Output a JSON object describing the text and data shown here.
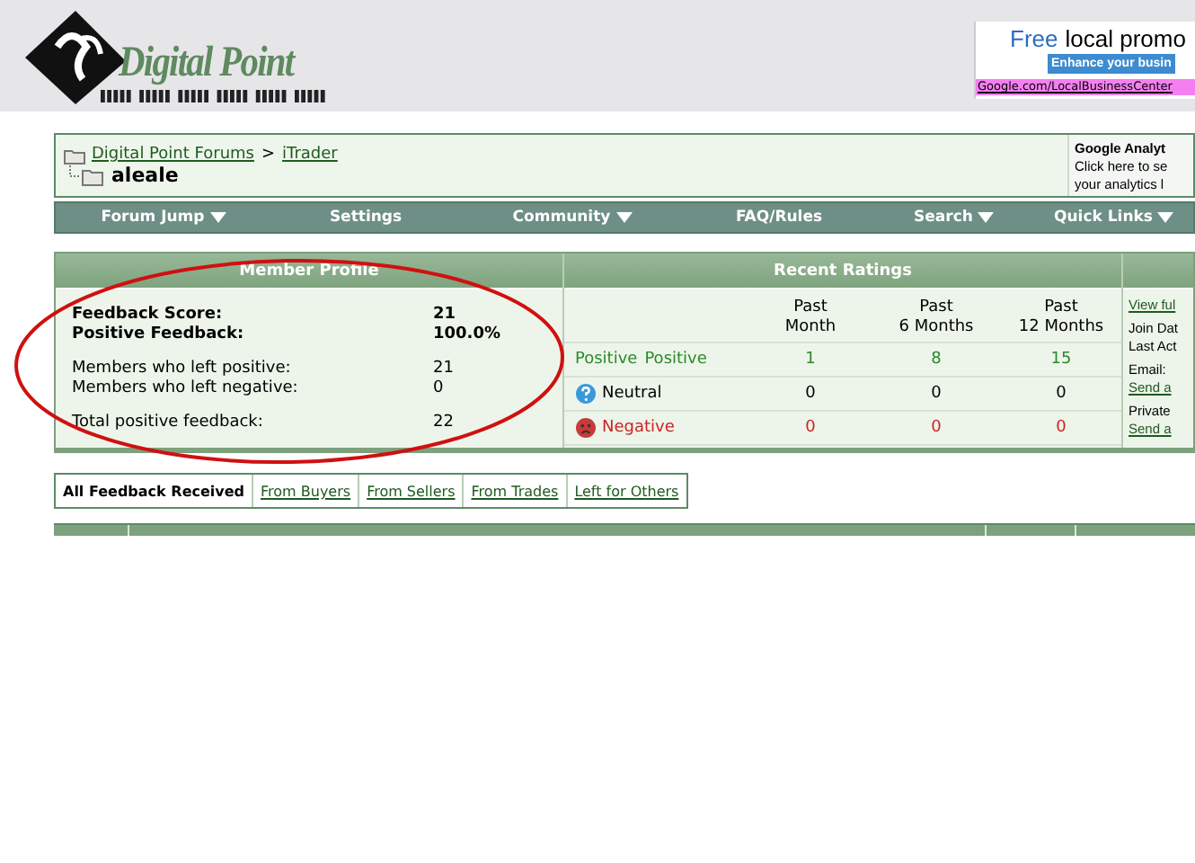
{
  "header": {
    "logo_text": "Digital Point",
    "ad": {
      "headline_free": "Free",
      "headline_rest": "local promo",
      "button": "Enhance your busin",
      "url": "Google.com/LocalBusinessCenter"
    }
  },
  "breadcrumb": {
    "links": [
      "Digital Point Forums",
      "iTrader"
    ],
    "separator": ">",
    "current": "aleale"
  },
  "side_promo": {
    "title": "Google Analyt",
    "lines": [
      "Click here to se",
      "your analytics l"
    ]
  },
  "navbar": [
    {
      "label": "Forum Jump",
      "has_menu": true
    },
    {
      "label": "Settings",
      "has_menu": false
    },
    {
      "label": "Community",
      "has_menu": true
    },
    {
      "label": "FAQ/Rules",
      "has_menu": false
    },
    {
      "label": "Search",
      "has_menu": true
    },
    {
      "label": "Quick Links",
      "has_menu": true
    }
  ],
  "member_profile": {
    "title": "Member Profile",
    "groups": [
      [
        {
          "label": "Feedback Score:",
          "value": "21",
          "bold": true
        },
        {
          "label": "Positive Feedback:",
          "value": "100.0%",
          "bold": true
        }
      ],
      [
        {
          "label": "Members who left positive:",
          "value": "21",
          "bold": false
        },
        {
          "label": "Members who left negative:",
          "value": "0",
          "bold": false
        }
      ],
      [
        {
          "label": "Total positive feedback:",
          "value": "22",
          "bold": false
        }
      ]
    ]
  },
  "recent_ratings": {
    "title": "Recent Ratings",
    "columns": [
      [
        "Past",
        "Month"
      ],
      [
        "Past",
        "6 Months"
      ],
      [
        "Past",
        "12 Months"
      ]
    ],
    "rows": [
      {
        "kind": "positive",
        "icon_text": "Positive",
        "label": "Positive",
        "values": [
          "1",
          "8",
          "15"
        ]
      },
      {
        "kind": "neutral",
        "label": "Neutral",
        "values": [
          "0",
          "0",
          "0"
        ]
      },
      {
        "kind": "negative",
        "label": "Negative",
        "values": [
          "0",
          "0",
          "0"
        ]
      }
    ]
  },
  "profile_side": [
    {
      "kind": "link",
      "text": "View ful"
    },
    {
      "kind": "text",
      "text": "Join Dat"
    },
    {
      "kind": "text",
      "text": "Last Act"
    },
    {
      "kind": "text",
      "text": "Email:"
    },
    {
      "kind": "link",
      "text": "Send a"
    },
    {
      "kind": "text",
      "text": "Private"
    },
    {
      "kind": "link",
      "text": "Send a"
    }
  ],
  "feedback_tabs": [
    {
      "label": "All Feedback Received",
      "selected": true
    },
    {
      "label": "From Buyers",
      "selected": false
    },
    {
      "label": "From Sellers",
      "selected": false
    },
    {
      "label": "From Trades",
      "selected": false
    },
    {
      "label": "Left for Others",
      "selected": false
    }
  ]
}
